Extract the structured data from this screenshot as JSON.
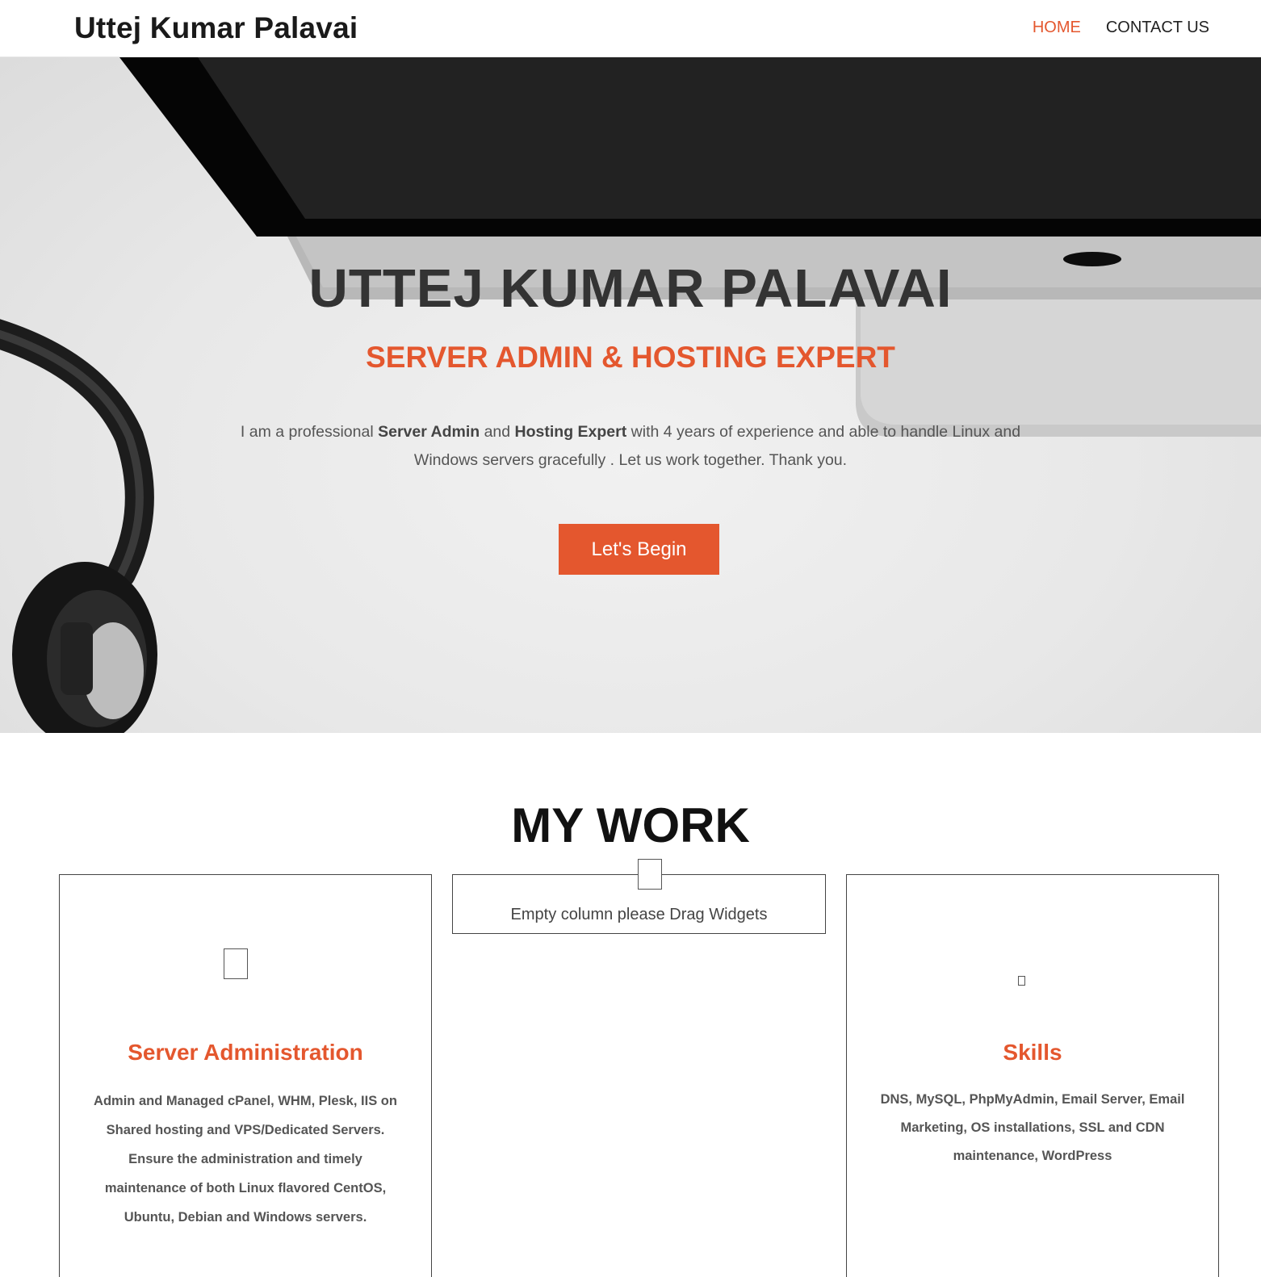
{
  "header": {
    "site_title": "Uttej Kumar Palavai",
    "nav": [
      {
        "label": "HOME",
        "active": true
      },
      {
        "label": "CONTACT US",
        "active": false
      }
    ]
  },
  "hero": {
    "title": "UTTEJ KUMAR PALAVAI",
    "subtitle": "SERVER ADMIN & HOSTING EXPERT",
    "desc_parts": {
      "p1": "I am a professional ",
      "b1": "Server Admin",
      "p2": " and ",
      "b2": "Hosting Expert",
      "p3": " with 4 years of experience and able to handle Linux and Windows servers gracefully . Let us work together. Thank you."
    },
    "cta_label": "Let's Begin"
  },
  "work": {
    "heading_light": "MY ",
    "heading_bold": "WORK",
    "cards": [
      {
        "title": "Server Administration",
        "text": "Admin and Managed cPanel, WHM, Plesk, IIS on Shared hosting and VPS/Dedicated Servers. Ensure the administration and timely maintenance of both Linux flavored CentOS, Ubuntu, Debian and Windows servers."
      },
      {
        "empty_text": "Empty column please Drag Widgets"
      },
      {
        "title": "Skills",
        "text": "DNS, MySQL, PhpMyAdmin, Email Server, Email Marketing, OS installations, SSL and CDN maintenance, WordPress"
      }
    ]
  },
  "colors": {
    "accent": "#e4572e",
    "text_dark": "#333333"
  }
}
